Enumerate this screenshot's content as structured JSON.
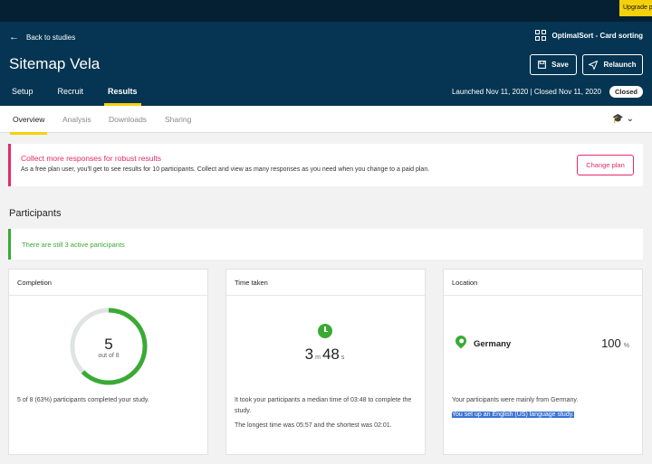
{
  "topbar": {
    "upgrade_label": "Upgrade pl"
  },
  "header": {
    "back_label": "Back to studies",
    "project_label": "OptimalSort - Card sorting",
    "title": "Sitemap Vela",
    "save_label": "Save",
    "relaunch_label": "Relaunch",
    "tabs": [
      {
        "label": "Setup",
        "active": false
      },
      {
        "label": "Recruit",
        "active": false
      },
      {
        "label": "Results",
        "active": true
      }
    ],
    "launched_text": "Launched Nov 11, 2020 | Closed Nov 11, 2020",
    "status_badge": "Closed"
  },
  "subnav": {
    "tabs": [
      {
        "label": "Overview",
        "active": true
      },
      {
        "label": "Analysis",
        "active": false
      },
      {
        "label": "Downloads",
        "active": false
      },
      {
        "label": "Sharing",
        "active": false
      }
    ]
  },
  "notice": {
    "title": "Collect more responses for robust results",
    "description": "As a free plan user, you'll get to see results for 10 participants. Collect and view as many responses as you need when you change to a paid plan.",
    "button": "Change plan"
  },
  "participants": {
    "heading": "Participants",
    "active_message": "There are still 3 active participants"
  },
  "completion": {
    "header": "Completion",
    "completed": 5,
    "total": 8,
    "value_text": "5",
    "out_of_text": "out of 8",
    "description": "5 of 8 (63%) participants completed your study."
  },
  "time_taken": {
    "header": "Time taken",
    "minutes": "3",
    "minutes_unit": "m",
    "seconds": "48",
    "seconds_unit": "s",
    "description": "It took your participants a median time of 03:48 to complete the study.",
    "range_text": "The longest time was 05:57 and the shortest was 02:01."
  },
  "location": {
    "header": "Location",
    "country": "Germany",
    "percent": "100",
    "percent_unit": "%",
    "description": "Your participants were mainly from Germany.",
    "language_text": "You set up an English (US) language study."
  },
  "colors": {
    "header_bg": "#053552",
    "accent_yellow": "#f5d10b",
    "accent_pink": "#e5296a",
    "accent_green": "#3aaa35"
  }
}
